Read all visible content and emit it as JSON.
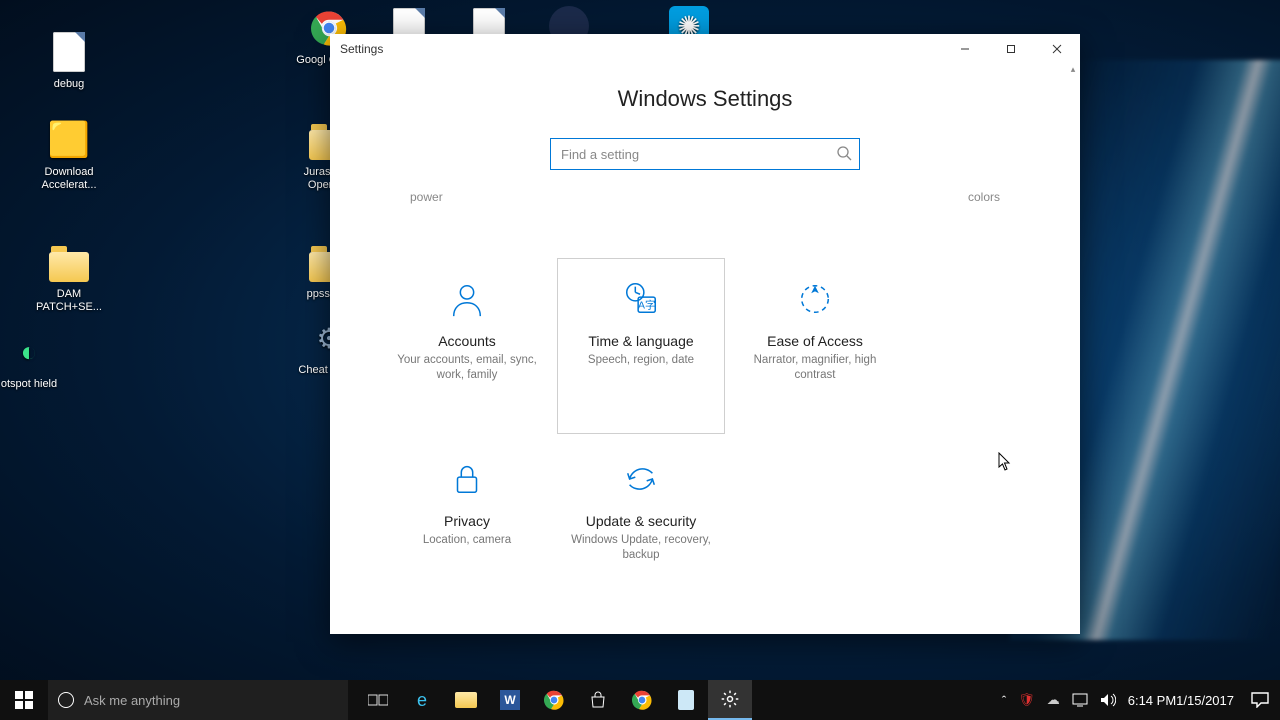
{
  "desktop_icons": {
    "debug": "debug",
    "download_accel": "Download Accelerat...",
    "dam_patch": "DAM PATCH+SE...",
    "hotspot": "otspot hield",
    "chrome": "Googl Chrom",
    "jurassic": "Jurassic P Operatio",
    "ppsspp": "ppsspp...",
    "cheat": "Cheat Eng..."
  },
  "settings_window": {
    "title": "Settings",
    "heading": "Windows Settings",
    "search_placeholder": "Find a setting",
    "hints": {
      "left": "power",
      "right": "colors"
    },
    "tiles": {
      "accounts": {
        "title": "Accounts",
        "desc": "Your accounts, email, sync, work, family"
      },
      "time_language": {
        "title": "Time & language",
        "desc": "Speech, region, date"
      },
      "ease_of_access": {
        "title": "Ease of Access",
        "desc": "Narrator, magnifier, high contrast"
      },
      "privacy": {
        "title": "Privacy",
        "desc": "Location, camera"
      },
      "update_security": {
        "title": "Update & security",
        "desc": "Windows Update, recovery, backup"
      }
    }
  },
  "taskbar": {
    "cortana_placeholder": "Ask me anything",
    "clock_time": "6:14 PM",
    "clock_date": "1/15/2017"
  }
}
